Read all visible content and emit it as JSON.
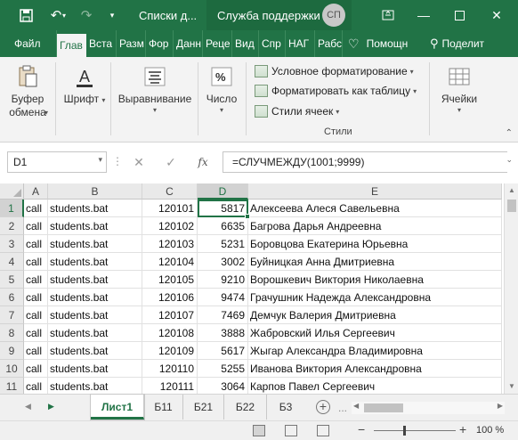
{
  "titlebar": {
    "doc_title": "Списки д...",
    "support": "Служба поддержки",
    "avatar_initials": "СП"
  },
  "ribbon_tabs": [
    "Файл",
    "Глав",
    "Вста",
    "Разм",
    "Фор",
    "Данн",
    "Реце",
    "Вид",
    "Спр",
    "НАГ",
    "Рабс",
    "Помощн",
    "Поделит"
  ],
  "ribbon": {
    "clipboard": "Буфер обмена",
    "font": "Шрифт",
    "alignment": "Выравнивание",
    "number": "Число",
    "cond_format": "Условное форматирование",
    "format_table": "Форматировать как таблицу",
    "cell_styles": "Стили ячеек",
    "styles_group": "Стили",
    "cells": "Ячейки"
  },
  "formula_bar": {
    "name_box": "D1",
    "fx": "fx",
    "formula": "=СЛУЧМЕЖДУ(1001;9999)"
  },
  "grid": {
    "columns": [
      "A",
      "B",
      "C",
      "D",
      "E"
    ],
    "selected_column": "D",
    "selected_row": 1,
    "rows": [
      {
        "n": "1",
        "a": "call",
        "b": "students.bat",
        "c": "120101",
        "d": "5817",
        "e": "Алексеева Алеся Савельевна"
      },
      {
        "n": "2",
        "a": "call",
        "b": "students.bat",
        "c": "120102",
        "d": "6635",
        "e": "Багрова Дарья Андреевна"
      },
      {
        "n": "3",
        "a": "call",
        "b": "students.bat",
        "c": "120103",
        "d": "5231",
        "e": "Боровцова Екатерина Юрьевна"
      },
      {
        "n": "4",
        "a": "call",
        "b": "students.bat",
        "c": "120104",
        "d": "3002",
        "e": "Буйницкая Анна Дмитриевна"
      },
      {
        "n": "5",
        "a": "call",
        "b": "students.bat",
        "c": "120105",
        "d": "9210",
        "e": "Ворошкевич Виктория Николаевна"
      },
      {
        "n": "6",
        "a": "call",
        "b": "students.bat",
        "c": "120106",
        "d": "9474",
        "e": "Грачушник Надежда Александровна"
      },
      {
        "n": "7",
        "a": "call",
        "b": "students.bat",
        "c": "120107",
        "d": "7469",
        "e": "Демчук Валерия Дмитриевна"
      },
      {
        "n": "8",
        "a": "call",
        "b": "students.bat",
        "c": "120108",
        "d": "3888",
        "e": "Жабровский Илья Сергеевич"
      },
      {
        "n": "9",
        "a": "call",
        "b": "students.bat",
        "c": "120109",
        "d": "5617",
        "e": "Жыгар Александра Владимировна"
      },
      {
        "n": "10",
        "a": "call",
        "b": "students.bat",
        "c": "120110",
        "d": "5255",
        "e": "Иванова Виктория Александровна"
      },
      {
        "n": "11",
        "a": "call",
        "b": "students.bat",
        "c": "120111",
        "d": "3064",
        "e": "Карпов Павел Сергеевич"
      }
    ]
  },
  "sheets": {
    "tabs": [
      "Лист1",
      "Б11",
      "Б21",
      "Б22",
      "Б3"
    ],
    "active": "Лист1",
    "more": "..."
  },
  "status": {
    "zoom_minus": "−",
    "zoom_plus": "+",
    "zoom": "100 %"
  },
  "colors": {
    "accent": "#217346",
    "titlebar": "#217346",
    "header_bg": "#e9e9e9"
  }
}
